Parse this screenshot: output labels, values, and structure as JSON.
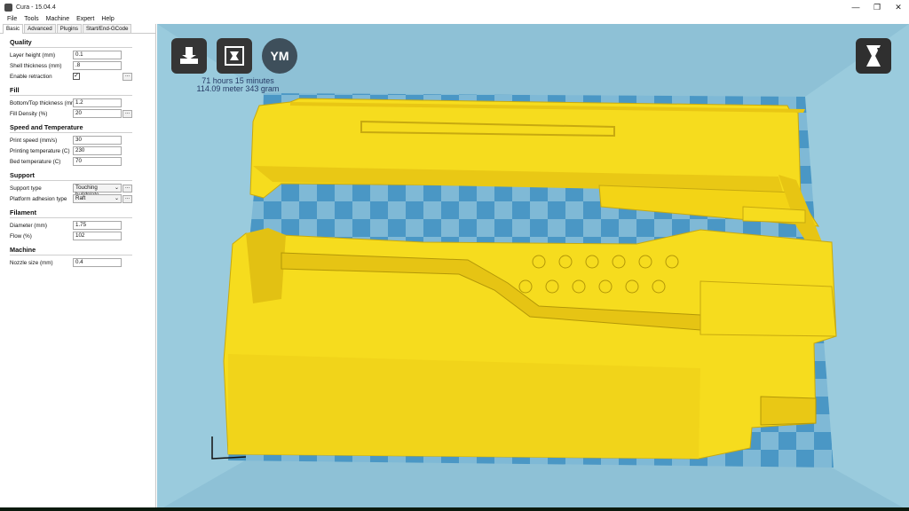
{
  "window": {
    "title": "Cura - 15.04.4"
  },
  "window_controls": {
    "minimize": "—",
    "maximize": "❐",
    "close": "✕"
  },
  "menu": [
    "File",
    "Tools",
    "Machine",
    "Expert",
    "Help"
  ],
  "tabs": [
    "Basic",
    "Advanced",
    "Plugins",
    "Start/End-GCode"
  ],
  "sections": {
    "quality": {
      "title": "Quality",
      "layer_height": {
        "label": "Layer height (mm)",
        "value": "0.1"
      },
      "shell_thickness": {
        "label": "Shell thickness (mm)",
        "value": ".8"
      },
      "enable_retraction": {
        "label": "Enable retraction",
        "checked": "✓"
      }
    },
    "fill": {
      "title": "Fill",
      "bottom_top": {
        "label": "Bottom/Top thickness (mm)",
        "value": "1.2"
      },
      "density": {
        "label": "Fill Density (%)",
        "value": "20"
      }
    },
    "speed": {
      "title": "Speed and Temperature",
      "print_speed": {
        "label": "Print speed (mm/s)",
        "value": "30"
      },
      "print_temp": {
        "label": "Printing temperature (C)",
        "value": "230"
      },
      "bed_temp": {
        "label": "Bed temperature (C)",
        "value": "70"
      }
    },
    "support": {
      "title": "Support",
      "support_type": {
        "label": "Support type",
        "value": "Touching buildplate"
      },
      "adhesion": {
        "label": "Platform adhesion type",
        "value": "Raft"
      }
    },
    "filament": {
      "title": "Filament",
      "diameter": {
        "label": "Diameter (mm)",
        "value": "1.75"
      },
      "flow": {
        "label": "Flow (%)",
        "value": "102"
      }
    },
    "machine": {
      "title": "Machine",
      "nozzle": {
        "label": "Nozzle size (mm)",
        "value": "0.4"
      }
    }
  },
  "more_button": "...",
  "print_info": {
    "time": "71 hours 15 minutes",
    "material": "114.09 meter 343 gram"
  },
  "toolbar": {
    "ym_label": "YM"
  },
  "icons": [
    "load-icon",
    "print-icon",
    "ym-icon",
    "view-mode-icon"
  ],
  "colors": {
    "model": "#f6dc1e",
    "bed_light": "#7fb9d6",
    "bed_dark": "#4a97c5",
    "background": "#8ec1d6"
  }
}
